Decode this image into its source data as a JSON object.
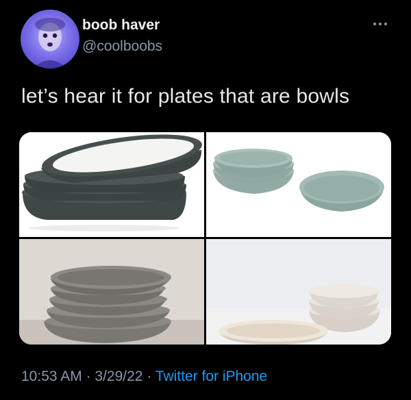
{
  "author": {
    "display_name": "boob haver",
    "handle": "@coolboobs",
    "avatar_icon": "avatar-photo"
  },
  "tweet": {
    "text": "let’s hear it for plates that are bowls",
    "media": [
      {
        "alt_icon": "dark-green-plate-stack-photo"
      },
      {
        "alt_icon": "sage-green-bowls-photo"
      },
      {
        "alt_icon": "speckled-grey-bowl-stack-photo"
      },
      {
        "alt_icon": "cream-bowls-photo"
      }
    ]
  },
  "meta": {
    "time": "10:53 AM",
    "sep1": "·",
    "date": "3/29/22",
    "sep2": "·",
    "source": "Twitter for iPhone"
  },
  "colors": {
    "background": "#000000",
    "primary_text": "#e7e9ea",
    "secondary_text": "#8b98a5",
    "link": "#1d9bf0"
  }
}
